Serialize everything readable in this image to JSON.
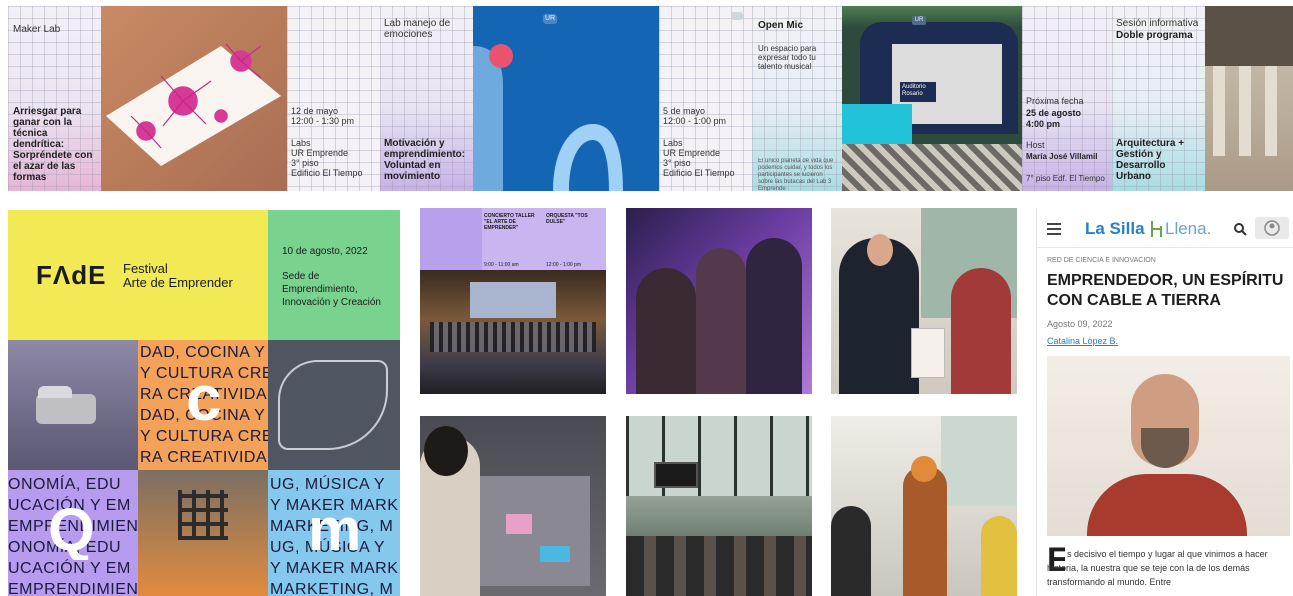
{
  "strip": {
    "maker_lab": {
      "label": "Maker Lab",
      "title": "Arriesgar para ganar con la técnica dendrítica: Sorpréndete con el azar de las formas"
    },
    "lab_emociones_info": {
      "date": "12 de mayo",
      "time": "12:00 - 1:30 pm",
      "place1": "Labs",
      "place2": "UR Emprende",
      "place3": "3° piso",
      "place4": "Edificio El Tiempo"
    },
    "lab_emociones": {
      "label": "Lab manejo de emociones",
      "title": "Motivación y emprendimiento: Voluntad en movimiento"
    },
    "open_mic_info": {
      "date": "5 de mayo",
      "time": "12:00 - 1:00 pm",
      "place1": "Labs",
      "place2": "UR Emprende",
      "place3": "3° piso",
      "place4": "Edificio El Tiempo"
    },
    "open_mic": {
      "title": "Open Mic",
      "desc": "Un espacio para expresar todo tu talento musical",
      "small": "El único planeta de vida que podemos cuidar, y todos los participantes se lucieron sobre las butacas del Lab 3 Emprende"
    },
    "sesion_info": {
      "label1": "Próxima fecha",
      "date": "25 de agosto",
      "time": "4:00 pm",
      "host_label": "Host",
      "host": "María José Villamil",
      "place": "7° piso Edf. El Tiempo"
    },
    "sesion": {
      "label": "Sesión informativa",
      "subtitle": "Doble programa",
      "title": "Arquitectura + Gestión y Desarrollo Urbano"
    },
    "blue_badge": "UR",
    "auditorium_badge": "UR",
    "auditorium_sign": "Auditorio Rosario"
  },
  "fade": {
    "logo": "FΛdE",
    "festival_line1": "Festival",
    "festival_line2": "Arte de Emprender",
    "date": "10 de agosto, 2022",
    "venue": "Sede de Emprendimiento, Innovación y Creación",
    "rows_mid": [
      "DAD, COCINA Y",
      "Y CULTURA CRE",
      "RA CREATIVIDA",
      "DAD, COCINA Y",
      "Y CULTURA CRE",
      "RA CREATIVIDAD"
    ],
    "rows_bottom": [
      "ONOMÍA, EDU",
      "UCACIÓN Y EM",
      "EMPRENDIMIEN",
      "ONOMÍA, EDU",
      "UCACIÓN Y EM",
      "EMPRENDIMIEN"
    ],
    "rows_right": [
      "UG, MÚSICA Y",
      "Y MAKER MARK",
      "MARKETING, M",
      "UG, MÚSICA Y",
      "Y MAKER MARK",
      "MARKETING, M"
    ],
    "letters": [
      "c",
      "Q",
      "m"
    ]
  },
  "concert": {
    "col1": "CONCIERTO TALLER \"EL ARTE DE EMPRENDER\"",
    "col2": "ORQUESTA \"TOS DULSE\"",
    "time1": "9:00 - 11:00 am",
    "time2": "12:00 - 1:00 pm"
  },
  "article": {
    "logo_main": "La Silla",
    "logo_sub": "Llena.",
    "section": "RED DE CIENCIA E INNOVACIÓN",
    "headline": "EMPRENDEDOR, UN ESPÍRITU CON CABLE A TIERRA",
    "date": "Agosto 09, 2022",
    "author": "Catalina López B.",
    "dropcap": "E",
    "body": "s decisivo el tiempo y lugar al que vinimos a hacer historia, la nuestra que se teje con la de los demás transformando al mundo. Entre"
  },
  "colors": {
    "accent_blue": "#2a80c8",
    "fade_yellow": "#f1ea55",
    "fade_green": "#79d38e",
    "fade_purple": "#b79bef",
    "fade_orange": "#f4a25a",
    "fade_blue": "#84c8ee",
    "royal_blue": "#1466b4"
  },
  "icons": [
    "menu-icon",
    "search-icon",
    "user-icon",
    "chair-icon"
  ]
}
